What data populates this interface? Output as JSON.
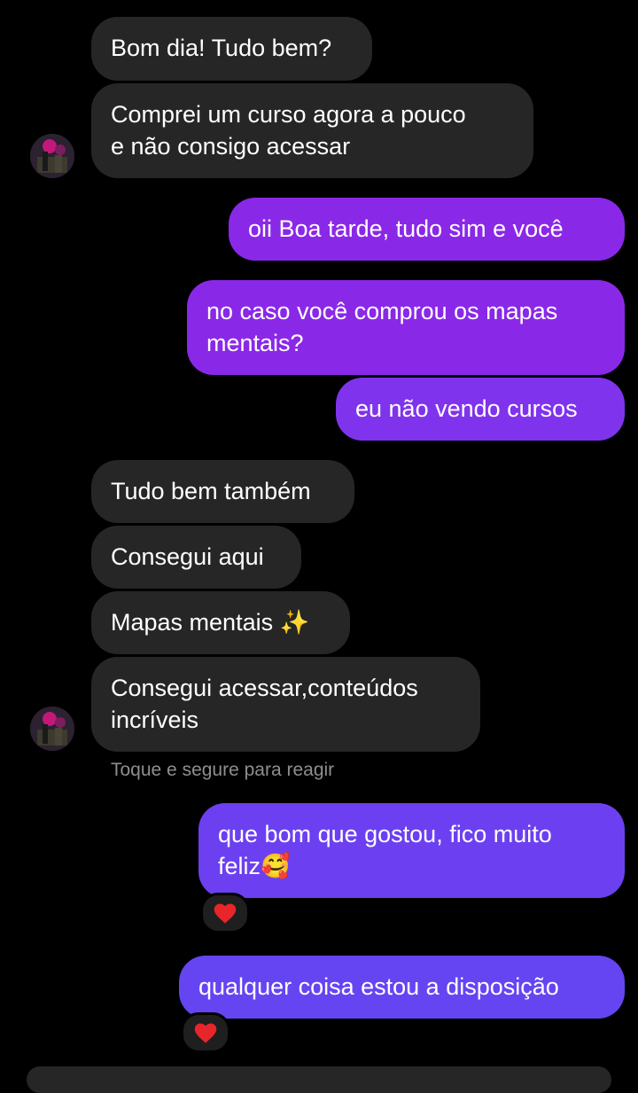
{
  "colors": {
    "incoming_bubble": "#262626",
    "outgoing_purple": "#8a28e8",
    "outgoing_indigo": "#6c40f0",
    "reaction_heart": "#e8252b",
    "hint_text": "#8e8e8e",
    "background": "#000000"
  },
  "messages": [
    {
      "id": 1,
      "direction": "incoming",
      "text": "Bom dia! Tudo bem?"
    },
    {
      "id": 2,
      "direction": "incoming",
      "text": "Comprei um curso agora a pouco\ne não consigo acessar"
    },
    {
      "id": 3,
      "direction": "outgoing",
      "text": "oii Boa tarde, tudo sim e você"
    },
    {
      "id": 4,
      "direction": "outgoing",
      "text": "no caso você comprou os mapas\nmentais?"
    },
    {
      "id": 5,
      "direction": "outgoing",
      "text": "eu não vendo cursos"
    },
    {
      "id": 6,
      "direction": "incoming",
      "text": "Tudo bem também"
    },
    {
      "id": 7,
      "direction": "incoming",
      "text": "Consegui aqui"
    },
    {
      "id": 8,
      "direction": "incoming",
      "text": "Mapas mentais ✨"
    },
    {
      "id": 9,
      "direction": "incoming",
      "text": "Consegui acessar,conteúdos\nincríveis"
    },
    {
      "id": 10,
      "direction": "outgoing",
      "text": "que bom que gostou, fico muito\nfeliz🥰",
      "reaction": "heart-icon"
    },
    {
      "id": 11,
      "direction": "outgoing",
      "text": "qualquer coisa estou a disposição",
      "reaction": "heart-icon"
    }
  ],
  "hint": "Toque e segure para reagir",
  "icons": {
    "avatar": "user-avatar",
    "reaction": "heart-icon"
  }
}
